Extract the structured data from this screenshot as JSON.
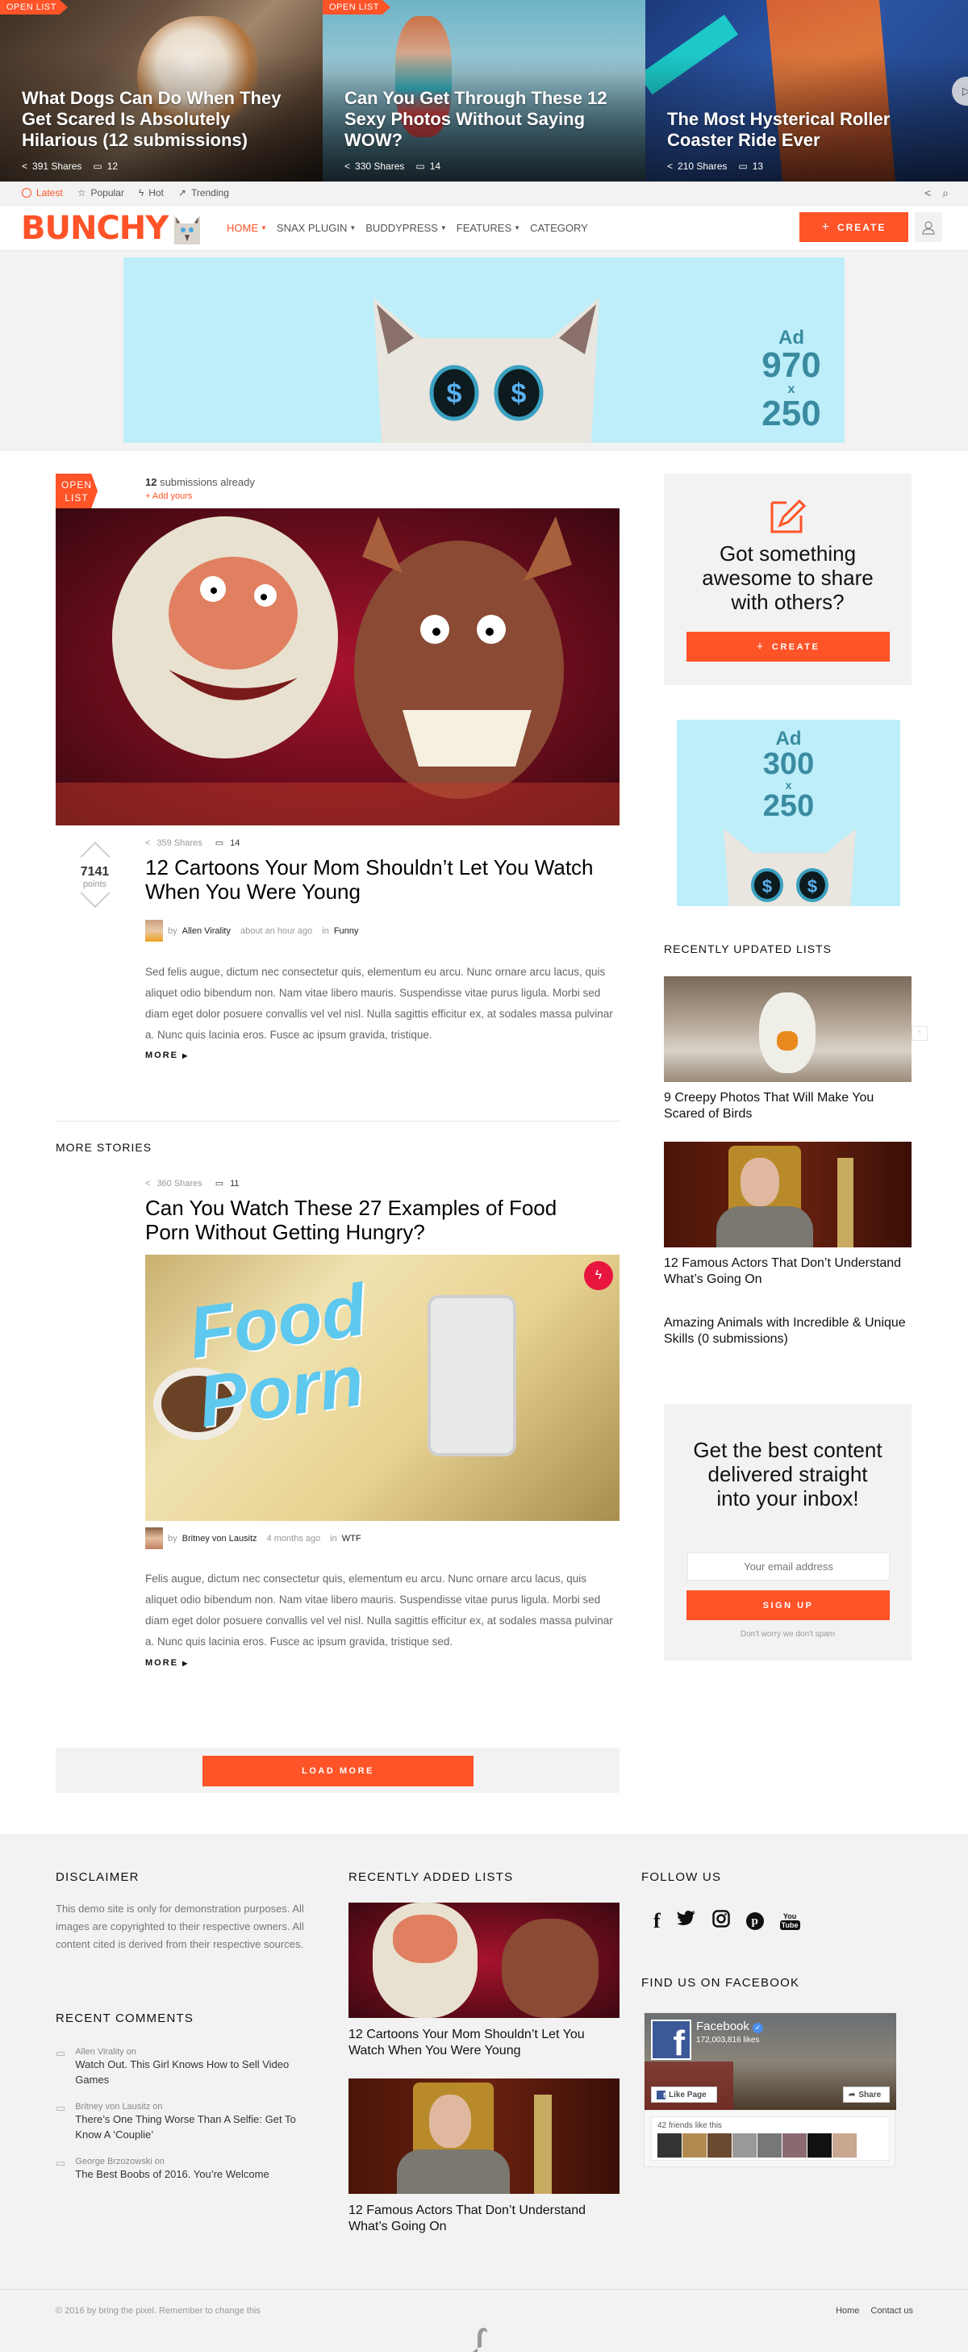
{
  "hero": [
    {
      "badge": "OPEN LIST",
      "title": "What Dogs Can Do When They Get Scared Is Absolutely Hilarious (12 submissions)",
      "shares": "391 Shares",
      "comments": "12"
    },
    {
      "badge": "OPEN LIST",
      "title": "Can You Get Through These 12 Sexy Photos Without Saying WOW?",
      "shares": "330 Shares",
      "comments": "14"
    },
    {
      "badge": "",
      "title": "The Most Hysterical Roller Coaster Ride Ever",
      "shares": "210 Shares",
      "comments": "13"
    }
  ],
  "strip": {
    "items": [
      {
        "label": "Latest",
        "icon": "clock-icon"
      },
      {
        "label": "Popular",
        "icon": "star-icon"
      },
      {
        "label": "Hot",
        "icon": "lightning-icon"
      },
      {
        "label": "Trending",
        "icon": "trending-icon"
      }
    ]
  },
  "header": {
    "logo": "BUNCHY",
    "nav": [
      {
        "label": "HOME",
        "caret": true
      },
      {
        "label": "SNAX PLUGIN",
        "caret": true
      },
      {
        "label": "BUDDYPRESS",
        "caret": true
      },
      {
        "label": "FEATURES",
        "caret": true
      },
      {
        "label": "CATEGORY",
        "caret": false
      }
    ],
    "create_label": "CREATE"
  },
  "ad_banner": {
    "ad": "Ad",
    "w": "970",
    "x": "x",
    "h": "250"
  },
  "featured": {
    "badge_line1": "OPEN",
    "badge_line2": "LIST",
    "submissions_count": "12",
    "submissions_text": " submissions already",
    "add_yours": "+ Add yours",
    "points": "7141",
    "points_label": "points",
    "shares": "359 Shares",
    "comments": "14",
    "title": "12 Cartoons Your Mom Shouldn’t Let You Watch When You Were Young",
    "by": "by",
    "author": "Allen Virality",
    "time": "about an hour ago",
    "in": "in",
    "category": "Funny",
    "excerpt": "Sed felis augue, dictum nec consectetur quis, elementum eu arcu. Nunc ornare arcu lacus, quis aliquet odio bibendum non. Nam vitae libero mauris. Suspendisse vitae purus ligula. Morbi sed diam eget dolor posuere convallis vel vel nisl. Nulla sagittis efficitur ex, at sodales massa pulvinar a. Nunc quis lacinia eros. Fusce ac ipsum gravida, tristique.",
    "more": "MORE"
  },
  "more_stories": {
    "heading": "MORE STORIES",
    "post": {
      "shares": "360 Shares",
      "comments": "11",
      "title": "Can You Watch These 27 Examples of Food Porn Without Getting Hungry?",
      "image_text_1": "Food",
      "image_text_2": "Porn",
      "by": "by",
      "author": "Britney von Lausitz",
      "time": "4 months ago",
      "in": "in",
      "category": "WTF",
      "excerpt": "Felis augue, dictum nec consectetur quis, elementum eu arcu. Nunc ornare arcu lacus, quis aliquet odio bibendum non. Nam vitae libero mauris. Suspendisse vitae purus ligula. Morbi sed diam eget dolor posuere convallis vel vel nisl. Nulla sagittis efficitur ex, at sodales massa pulvinar a. Nunc quis lacinia eros. Fusce ac ipsum gravida, tristique sed.",
      "more": "MORE"
    },
    "load_more": "LOAD MORE"
  },
  "sidebar": {
    "cta_title": "Got something awesome to share with others?",
    "cta_button": "CREATE",
    "ad": {
      "ad": "Ad",
      "w": "300",
      "x": "x",
      "h": "250"
    },
    "recent_heading": "RECENTLY UPDATED LISTS",
    "recent": [
      {
        "title": "9 Creepy Photos That Will Make You Scared of Birds"
      },
      {
        "title": "12 Famous Actors That Don’t Understand What’s Going On"
      },
      {
        "title": "Amazing Animals with Incredible & Unique Skills (0 submissions)"
      }
    ],
    "newsletter_title": "Get the best content delivered straight into your inbox!",
    "email_placeholder": "Your email address",
    "signup": "SIGN UP",
    "nospam": "Don't worry we don't spam"
  },
  "footer": {
    "disclaimer_heading": "DISCLAIMER",
    "disclaimer_text": "This demo site is only for demonstration purposes. All images are copyrighted to their respective owners. All content cited is derived from their respective sources.",
    "comments_heading": "RECENT COMMENTS",
    "comments": [
      {
        "author": "Allen Virality",
        "on": "on",
        "title": "Watch Out. This Girl Knows How to Sell Video Games"
      },
      {
        "author": "Britney von Lausitz",
        "on": "on",
        "title": "There’s One Thing Worse Than A Selfie: Get To Know A ‘Couplie’"
      },
      {
        "author": "George Brzozowski",
        "on": "on",
        "title": "The Best Boobs of 2016. You’re Welcome"
      }
    ],
    "added_heading": "RECENTLY ADDED LISTS",
    "added": [
      {
        "title": "12 Cartoons Your Mom Shouldn’t Let You Watch When You Were Young"
      },
      {
        "title": "12 Famous Actors That Don’t Understand What’s Going On"
      }
    ],
    "follow_heading": "FOLLOW US",
    "social": [
      "facebook-icon",
      "twitter-icon",
      "instagram-icon",
      "pinterest-icon",
      "youtube-icon"
    ],
    "fb_heading": "FIND US ON FACEBOOK",
    "fb": {
      "name": "Facebook",
      "likes": "172,003,816 likes",
      "like_page": "Like Page",
      "share": "Share",
      "friends": "42 friends like this"
    },
    "copyright": "© 2016 by bring the pixel. Remember to change this",
    "links": [
      "Home",
      "Contact us"
    ]
  },
  "colors": {
    "accent": "#ff5328",
    "ad_bg": "#bdeefa",
    "ad_text": "#3a8ba0",
    "gray_bg": "#f2f2f2"
  }
}
